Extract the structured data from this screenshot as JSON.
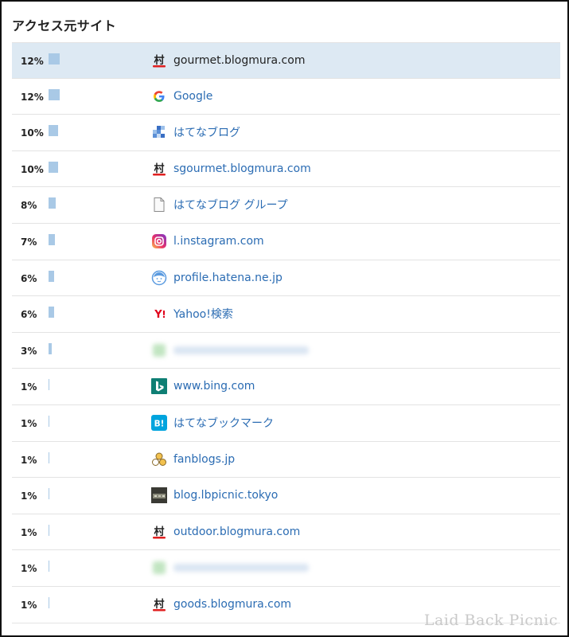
{
  "section_title": "アクセス元サイト",
  "watermark": "Laid Back Picnic",
  "bar_color": "#a9c9e6",
  "link_color": "#2b6cb3",
  "selected_row_color": "#dde9f3",
  "rows": [
    {
      "pct": "12%",
      "share": 12,
      "name": "gourmet.blogmura.com",
      "icon": "blogmura-icon",
      "selected": true
    },
    {
      "pct": "12%",
      "share": 12,
      "name": "Google",
      "icon": "google-icon"
    },
    {
      "pct": "10%",
      "share": 10,
      "name": "はてなブログ",
      "icon": "hatena-blog-icon"
    },
    {
      "pct": "10%",
      "share": 10,
      "name": "sgourmet.blogmura.com",
      "icon": "blogmura-icon"
    },
    {
      "pct": "8%",
      "share": 8,
      "name": "はてなブログ グループ",
      "icon": "document-icon"
    },
    {
      "pct": "7%",
      "share": 7,
      "name": "l.instagram.com",
      "icon": "instagram-icon"
    },
    {
      "pct": "6%",
      "share": 6,
      "name": "profile.hatena.ne.jp",
      "icon": "hatena-profile-icon"
    },
    {
      "pct": "6%",
      "share": 6,
      "name": "Yahoo!検索",
      "icon": "yahoo-icon"
    },
    {
      "pct": "3%",
      "share": 3,
      "name": "",
      "icon": "blurred-favicon-icon",
      "blurred": true
    },
    {
      "pct": "1%",
      "share": 1,
      "name": "www.bing.com",
      "icon": "bing-icon"
    },
    {
      "pct": "1%",
      "share": 1,
      "name": "はてなブックマーク",
      "icon": "hatena-bookmark-icon"
    },
    {
      "pct": "1%",
      "share": 1,
      "name": "fanblogs.jp",
      "icon": "fanblogs-icon"
    },
    {
      "pct": "1%",
      "share": 1,
      "name": "blog.lbpicnic.tokyo",
      "icon": "site-thumbnail-icon"
    },
    {
      "pct": "1%",
      "share": 1,
      "name": "outdoor.blogmura.com",
      "icon": "blogmura-icon"
    },
    {
      "pct": "1%",
      "share": 1,
      "name": "",
      "icon": "blurred-favicon-icon",
      "blurred": true
    },
    {
      "pct": "1%",
      "share": 1,
      "name": "goods.blogmura.com",
      "icon": "blogmura-icon"
    }
  ]
}
